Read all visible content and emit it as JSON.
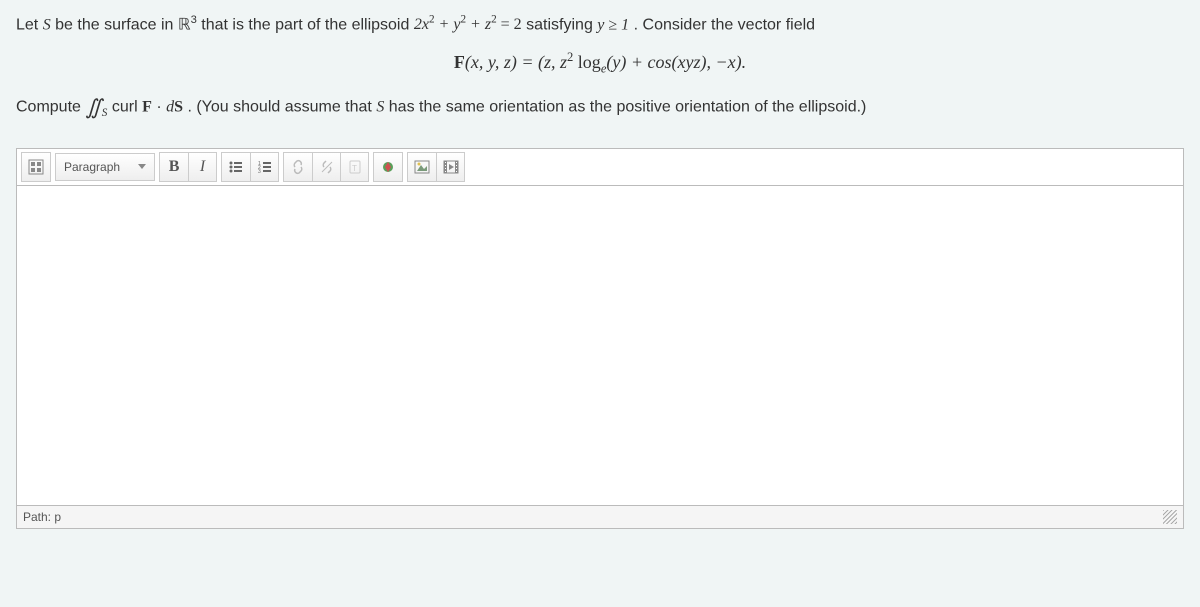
{
  "problem": {
    "line1_pre": "Let ",
    "S": "S",
    "line1_mid1": " be the surface in ",
    "R": "ℝ",
    "R_sup": "3",
    "line1_mid2": " that is the part of the ellipsoid ",
    "eq1_a": "2x",
    "eq1_a_sup": "2",
    "eq1_plus": " + ",
    "eq1_b": "y",
    "eq1_b_sup": "2",
    "eq1_c": "z",
    "eq1_c_sup": "2",
    "eq1_rhs": " = 2",
    "line1_mid3": " satisfying ",
    "cond": "y ≥ 1",
    "line1_end": ". Consider the vector field",
    "formula_F": "F",
    "formula_args": "(x, y, z) = (z, z",
    "formula_z_sup": "2",
    "formula_log": " log",
    "formula_log_sub": "e",
    "formula_rest": "(y) + cos(xyz), −x).",
    "compute_pre": "Compute ",
    "integral": "∬",
    "integral_sub": "S",
    "compute_mid1": " curl ",
    "F2": "F",
    "dot": " · ",
    "dS_d": "d",
    "dS_S": "S",
    "compute_mid2": ". (You should assume that ",
    "S2": "S",
    "compute_end": " has the same orientation as the positive orientation of the ellipsoid.)"
  },
  "editor": {
    "format_label": "Paragraph",
    "path_label": "Path: p"
  }
}
